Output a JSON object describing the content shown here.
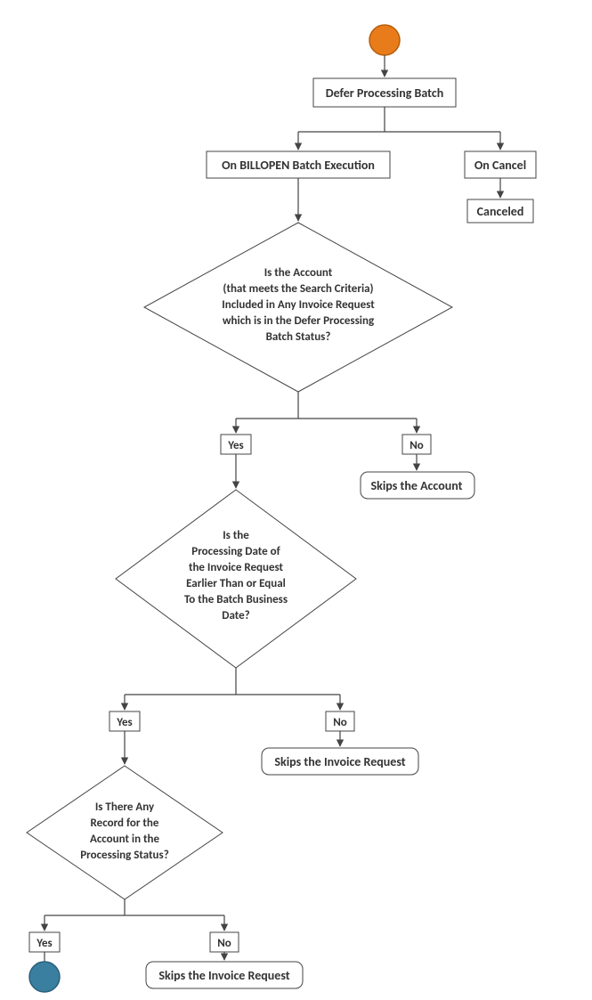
{
  "nodes": {
    "start": "",
    "deferProcessing": "Defer Processing Batch",
    "onBillopen": "On BILLOPEN Batch Execution",
    "onCancel": "On Cancel",
    "canceled": "Canceled",
    "decision1_line1": "Is the Account",
    "decision1_line2": "(that meets the Search Criteria)",
    "decision1_line3": "Included in Any Invoice Request",
    "decision1_line4": "which is in the Defer Processing",
    "decision1_line5": "Batch Status?",
    "decision2_line1": "Is the",
    "decision2_line2": "Processing Date of",
    "decision2_line3": "the Invoice Request",
    "decision2_line4": "Earlier Than or Equal",
    "decision2_line5": "To the Batch Business",
    "decision2_line6": "Date?",
    "decision3_line1": "Is There Any",
    "decision3_line2": "Record for the",
    "decision3_line3": "Account in the",
    "decision3_line4": "Processing Status?",
    "yes": "Yes",
    "no": "No",
    "skipsAccount": "Skips the Account",
    "skipsInvoice": "Skips the Invoice Request"
  },
  "chart_data": {
    "type": "flowchart",
    "title": "",
    "nodes": [
      {
        "id": "start",
        "type": "start",
        "label": ""
      },
      {
        "id": "defer",
        "type": "process",
        "label": "Defer Processing Batch"
      },
      {
        "id": "onBillopen",
        "type": "process",
        "label": "On BILLOPEN Batch Execution"
      },
      {
        "id": "onCancel",
        "type": "process",
        "label": "On Cancel"
      },
      {
        "id": "canceled",
        "type": "terminator",
        "label": "Canceled"
      },
      {
        "id": "d1",
        "type": "decision",
        "label": "Is the Account (that meets the Search Criteria) Included in Any Invoice Request which is in the Defer Processing Batch Status?"
      },
      {
        "id": "skipsAccount",
        "type": "terminator",
        "label": "Skips the Account"
      },
      {
        "id": "d2",
        "type": "decision",
        "label": "Is the Processing Date of the Invoice Request Earlier Than or Equal To the Batch Business Date?"
      },
      {
        "id": "skipsInvoice1",
        "type": "terminator",
        "label": "Skips the Invoice Request"
      },
      {
        "id": "d3",
        "type": "decision",
        "label": "Is There Any Record for the Account in the Processing Status?"
      },
      {
        "id": "end",
        "type": "end",
        "label": ""
      },
      {
        "id": "skipsInvoice2",
        "type": "terminator",
        "label": "Skips the Invoice Request"
      }
    ],
    "edges": [
      {
        "from": "start",
        "to": "defer"
      },
      {
        "from": "defer",
        "to": "onBillopen"
      },
      {
        "from": "defer",
        "to": "onCancel"
      },
      {
        "from": "onCancel",
        "to": "canceled"
      },
      {
        "from": "onBillopen",
        "to": "d1"
      },
      {
        "from": "d1",
        "to": "d2",
        "label": "Yes"
      },
      {
        "from": "d1",
        "to": "skipsAccount",
        "label": "No"
      },
      {
        "from": "d2",
        "to": "d3",
        "label": "Yes"
      },
      {
        "from": "d2",
        "to": "skipsInvoice1",
        "label": "No"
      },
      {
        "from": "d3",
        "to": "end",
        "label": "Yes"
      },
      {
        "from": "d3",
        "to": "skipsInvoice2",
        "label": "No"
      }
    ]
  }
}
